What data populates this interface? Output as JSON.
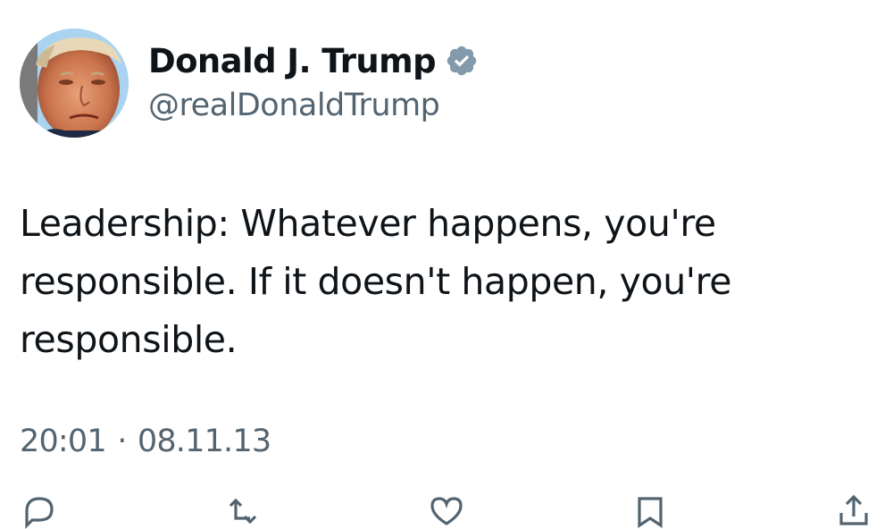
{
  "author": {
    "display_name": "Donald J. Trump",
    "handle": "@realDonaldTrump",
    "verified": true,
    "verified_color": "#829aab"
  },
  "tweet": {
    "text": "Leadership: Whatever happens, you're\nresponsible. If it doesn't happen, you're\nresponsible.",
    "time": "20:01",
    "separator": "·",
    "date": "08.11.13"
  },
  "actions": {
    "icons": [
      "reply-icon",
      "retweet-icon",
      "like-icon",
      "bookmark-icon",
      "share-icon"
    ]
  },
  "colors": {
    "text": "#0f1419",
    "secondary": "#536471",
    "background": "#ffffff"
  }
}
